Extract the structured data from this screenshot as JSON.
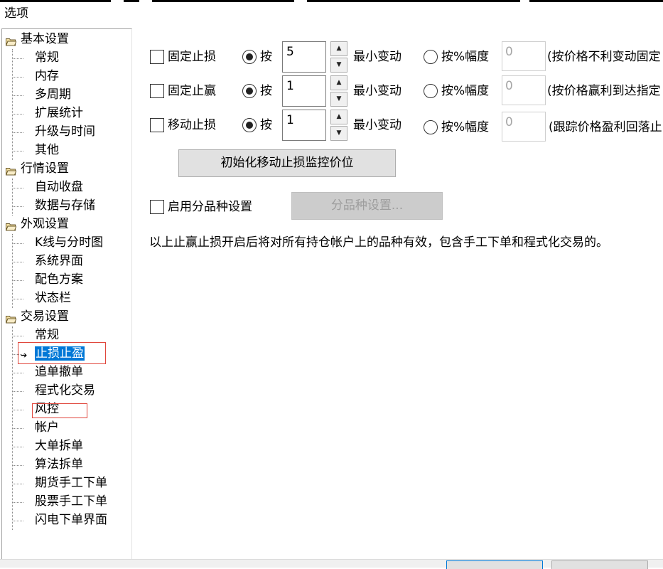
{
  "window": {
    "title": "选项"
  },
  "tree": {
    "categories": [
      {
        "label": "基本设置",
        "children": [
          "常规",
          "内存",
          "多周期",
          "扩展统计",
          "升级与时间",
          "其他"
        ]
      },
      {
        "label": "行情设置",
        "children": [
          "自动收盘",
          "数据与存储"
        ]
      },
      {
        "label": "外观设置",
        "children": [
          "K线与分时图",
          "系统界面",
          "配色方案",
          "状态栏"
        ]
      },
      {
        "label": "交易设置",
        "children": [
          "常规",
          "止损止盈",
          "追单撤单",
          "程式化交易",
          "风控",
          "帐户",
          "大单拆单",
          "算法拆单",
          "期货手工下单",
          "股票手工下单",
          "闪电下单界面"
        ]
      }
    ],
    "selected": "止损止盈"
  },
  "stop_rows": [
    {
      "checkbox_label": "固定止损",
      "by_label": "按",
      "value": "5",
      "unit": "最小变动",
      "pct_label": "按%幅度",
      "pct_value": "0",
      "desc": "(按价格不利变动固定"
    },
    {
      "checkbox_label": "固定止赢",
      "by_label": "按",
      "value": "1",
      "unit": "最小变动",
      "pct_label": "按%幅度",
      "pct_value": "0",
      "desc": "(按价格赢利到达指定"
    },
    {
      "checkbox_label": "移动止损",
      "by_label": "按",
      "value": "1",
      "unit": "最小变动",
      "pct_label": "按%幅度",
      "pct_value": "0",
      "desc": "(跟踪价格盈利回落止"
    }
  ],
  "init_button": {
    "label": "初始化移动止损监控价位"
  },
  "per_product": {
    "checkbox_label": "启用分品种设置",
    "button_label": "分品种设置..."
  },
  "note": "以上止赢止损开启后将对所有持仓帐户上的品种有效，包含手工下单和程式化交易的。",
  "icons": {
    "folder": "folder-open-icon",
    "arrow": "pointer-arrow-icon",
    "spin_up": "spin-up-icon",
    "spin_down": "spin-down-icon"
  },
  "colors": {
    "selection": "#0078d7",
    "highlight_box": "#e0463c",
    "disabled_text": "#9d9d9d"
  }
}
